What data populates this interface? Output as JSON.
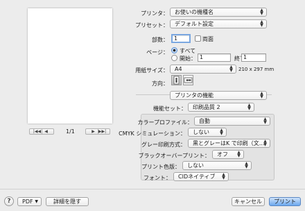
{
  "printer": {
    "label": "プリンタ：",
    "value": "お使いの機種名"
  },
  "preset": {
    "label": "プリセット：",
    "value": "デフォルト設定"
  },
  "copies": {
    "label": "部数：",
    "value": "1",
    "duplex_label": "両面"
  },
  "pages": {
    "label": "ページ：",
    "all_label": "すべて",
    "from_label": "開始：",
    "from_value": "1",
    "to_label": "終了：",
    "to_value": "1",
    "selected": "all"
  },
  "paper": {
    "label": "用紙サイズ：",
    "value": "A4",
    "dimensions": "210 x 297 mm"
  },
  "orientation": {
    "label": "方向：",
    "selected": "portrait"
  },
  "section_popup": {
    "value": "プリンタの機能"
  },
  "feature_set": {
    "label": "機能セット：",
    "value": "印刷品質 2"
  },
  "features": [
    {
      "label": "カラープロファイル：",
      "value": "自動"
    },
    {
      "label": "CMYK シミュレーション：",
      "value": "しない"
    },
    {
      "label": "グレー印刷方式：",
      "value": "黒とグレーはK で印刷（文…"
    },
    {
      "label": "ブラックオーバープリント：",
      "value": "オフ"
    },
    {
      "label": "プリント色版：",
      "value": "しない"
    },
    {
      "label": "フォント：",
      "value": "CIDネイティブ"
    }
  ],
  "preview": {
    "page_indicator": "1/1"
  },
  "footer": {
    "help": "?",
    "pdf_label": "PDF",
    "hide_details_label": "詳細を隠す",
    "cancel_label": "キャンセル",
    "print_label": "プリント"
  },
  "colors": {
    "primary_button": "#6ba8ee",
    "window_bg": "#ececec"
  }
}
